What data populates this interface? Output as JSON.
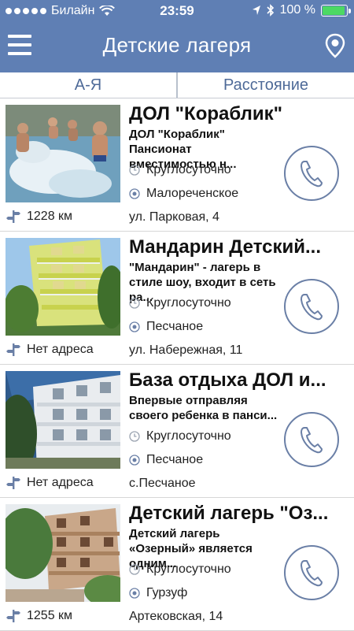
{
  "status_bar": {
    "carrier": "Билайн",
    "time": "23:59",
    "battery": "100 %",
    "battery_level": 1.0
  },
  "header": {
    "title": "Детские лагеря"
  },
  "tabs": [
    {
      "label": "А-Я"
    },
    {
      "label": "Расстояние"
    }
  ],
  "camps": [
    {
      "title": "ДОЛ \"Кораблик\"",
      "description": "ДОЛ \"Кораблик\" Пансионат вместимостью н...",
      "hours": "Круглосуточно",
      "place": "Малореченское",
      "address": "ул. Парковая, 4",
      "distance": "1228 км"
    },
    {
      "title": "Мандарин Детский...",
      "description": "\"Мандарин\" - лагерь в стиле шоу, входит в сеть ра...",
      "hours": "Круглосуточно",
      "place": "Песчаное",
      "address": "ул. Набережная, 11",
      "distance": "Нет адреса"
    },
    {
      "title": "База отдыха ДОЛ и...",
      "description": "Впервые отправляя своего ребенка в панси...",
      "hours": "Круглосуточно",
      "place": "Песчаное",
      "address": "с.Песчаное",
      "distance": "Нет адреса"
    },
    {
      "title": "Детский лагерь \"Оз...",
      "description": "Детский лагерь «Озерный» является одним...",
      "hours": "Круглосуточно",
      "place": "Гурзуф",
      "address": "Артековская, 14",
      "distance": "1255 км"
    }
  ]
}
